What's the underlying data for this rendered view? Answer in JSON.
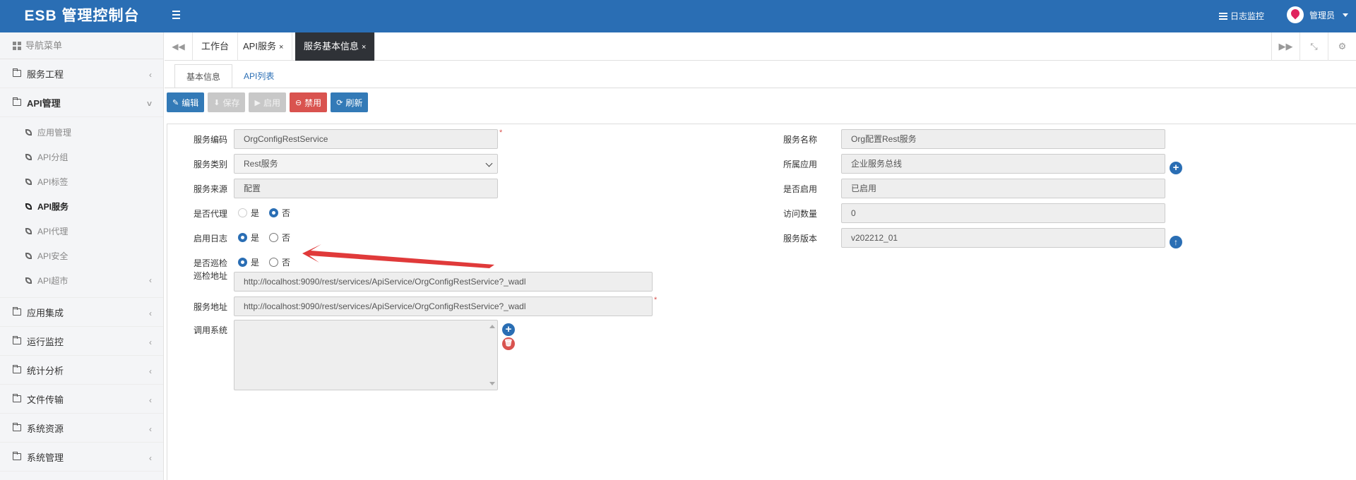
{
  "app": {
    "title": "ESB 管理控制台"
  },
  "header": {
    "log_monitor": "日志监控",
    "user_name": "管理员"
  },
  "sidebar": {
    "heading": "导航菜单",
    "items": [
      {
        "label": "服务工程"
      },
      {
        "label": "API管理",
        "expanded": true,
        "children": [
          {
            "label": "应用管理"
          },
          {
            "label": "API分组"
          },
          {
            "label": "API标签"
          },
          {
            "label": "API服务",
            "active": true
          },
          {
            "label": "API代理"
          },
          {
            "label": "API安全"
          },
          {
            "label": "API超市"
          }
        ]
      },
      {
        "label": "应用集成"
      },
      {
        "label": "运行监控"
      },
      {
        "label": "统计分析"
      },
      {
        "label": "文件传输"
      },
      {
        "label": "系统资源"
      },
      {
        "label": "系统管理"
      }
    ]
  },
  "tabs": [
    {
      "label": "工作台"
    },
    {
      "label": "API服务",
      "close": "×"
    },
    {
      "label": "服务基本信息",
      "close": "×",
      "active": true
    }
  ],
  "subtabs": [
    {
      "label": "基本信息",
      "active": true
    },
    {
      "label": "API列表"
    }
  ],
  "toolbar": {
    "edit": "编辑",
    "save": "保存",
    "enable": "启用",
    "disable": "禁用",
    "refresh": "刷新"
  },
  "form": {
    "service_code": {
      "label": "服务编码",
      "value": "OrgConfigRestService",
      "required": "*"
    },
    "service_type": {
      "label": "服务类别",
      "value": "Rest服务"
    },
    "service_source": {
      "label": "服务来源",
      "value": "配置"
    },
    "is_proxy": {
      "label": "是否代理",
      "options": [
        "是",
        "否"
      ],
      "selected": "否"
    },
    "enable_log": {
      "label": "启用日志",
      "options": [
        "是",
        "否"
      ],
      "selected": "是"
    },
    "is_patrol": {
      "label": "是否巡检",
      "options": [
        "是",
        "否"
      ],
      "selected": "是"
    },
    "patrol_url": {
      "label": "巡检地址",
      "value": "http://localhost:9090/rest/services/ApiService/OrgConfigRestService?_wadl"
    },
    "service_url": {
      "label": "服务地址",
      "value": "http://localhost:9090/rest/services/ApiService/OrgConfigRestService?_wadl",
      "required": "*"
    },
    "caller_systems": {
      "label": "调用系统"
    },
    "service_name": {
      "label": "服务名称",
      "value": "Org配置Rest服务"
    },
    "owner_app": {
      "label": "所属应用",
      "value": "企业服务总线"
    },
    "is_enabled": {
      "label": "是否启用",
      "value": "已启用"
    },
    "visit_count": {
      "label": "访问数量",
      "value": "0"
    },
    "service_version": {
      "label": "服务版本",
      "value": "v202212_01"
    }
  },
  "colors": {
    "primary": "#2a6eb4",
    "danger": "#d9534f",
    "tab_active": "#2f3237",
    "annotation": "#e03a3a"
  }
}
